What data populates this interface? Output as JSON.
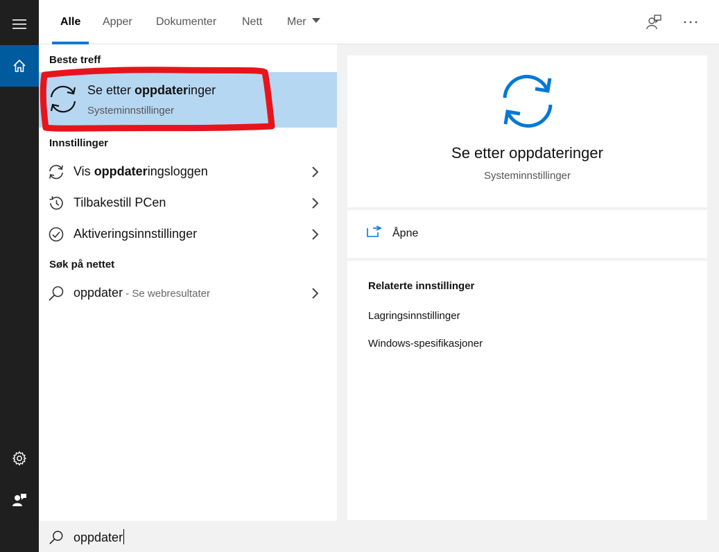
{
  "tabs": [
    {
      "label": "Alle",
      "active": true
    },
    {
      "label": "Apper"
    },
    {
      "label": "Dokumenter"
    },
    {
      "label": "Nett"
    },
    {
      "label": "Mer"
    }
  ],
  "left": {
    "best_match_header": "Beste treff",
    "best_match": {
      "title_prefix": "Se etter ",
      "title_bold": "oppdater",
      "title_suffix": "inger",
      "subtitle": "Systeminnstillinger",
      "icon": "sync-icon"
    },
    "settings_header": "Innstillinger",
    "settings_items": [
      {
        "prefix": "Vis ",
        "bold": "oppdater",
        "suffix": "ingsloggen",
        "icon": "sync-icon"
      },
      {
        "prefix": "Tilbakestill PCen",
        "bold": "",
        "suffix": "",
        "icon": "history-icon"
      },
      {
        "prefix": "Aktiveringsinnstillinger",
        "bold": "",
        "suffix": "",
        "icon": "check-circle-icon"
      }
    ],
    "web_header": "Søk på nettet",
    "web_item": {
      "query": "oppdater",
      "suffix": " - Se webresultater",
      "icon": "search-icon"
    }
  },
  "right": {
    "title": "Se etter oppdateringer",
    "subtitle": "Systeminnstillinger",
    "open_label": "Åpne",
    "related_header": "Relaterte innstillinger",
    "related_links": [
      "Lagringsinnstillinger",
      "Windows-spesifikasjoner"
    ]
  },
  "search": {
    "value": "oppdater"
  },
  "colors": {
    "accent": "#0078d7",
    "selected_bg": "#b6d7f2",
    "rail_bg": "#1f1f1f",
    "highlight_marker": "#e8141c"
  }
}
